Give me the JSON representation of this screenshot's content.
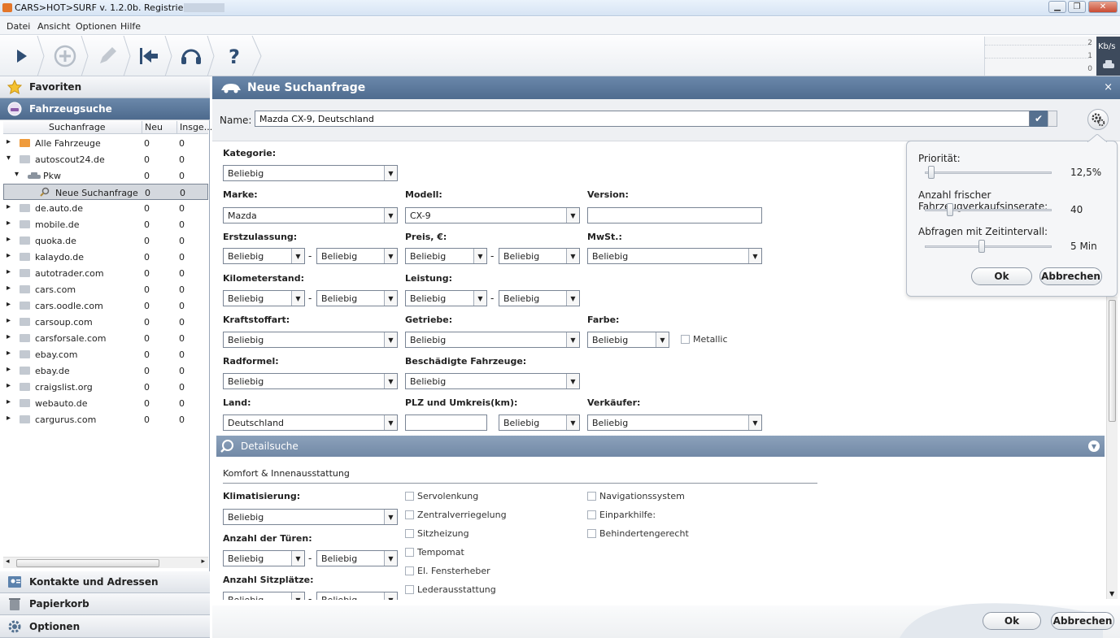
{
  "window": {
    "title": "CARS>HOT>SURF v. 1.2.0b. Registriert für"
  },
  "menu": {
    "items": [
      "Datei",
      "Ansicht",
      "Optionen",
      "Hilfe"
    ]
  },
  "speed": {
    "labels": [
      "2",
      "1",
      "0"
    ],
    "unit": "Kb/s"
  },
  "left": {
    "favorites": "Favoriten",
    "vehicle_search": "Fahrzeugsuche",
    "contacts": "Kontakte und Adressen",
    "trash": "Papierkorb",
    "options": "Optionen",
    "tree_headers": {
      "query": "Suchanfrage",
      "new": "Neu",
      "total": "Insge..."
    },
    "tree": [
      {
        "label": "Alle Fahrzeuge",
        "neu": "0",
        "insg": "0"
      },
      {
        "label": "autoscout24.de",
        "neu": "0",
        "insg": "0"
      },
      {
        "label": "Pkw",
        "neu": "0",
        "insg": "0"
      },
      {
        "label": "Neue Suchanfrage",
        "neu": "0",
        "insg": "0"
      },
      {
        "label": "de.auto.de",
        "neu": "0",
        "insg": "0"
      },
      {
        "label": "mobile.de",
        "neu": "0",
        "insg": "0"
      },
      {
        "label": "quoka.de",
        "neu": "0",
        "insg": "0"
      },
      {
        "label": "kalaydo.de",
        "neu": "0",
        "insg": "0"
      },
      {
        "label": "autotrader.com",
        "neu": "0",
        "insg": "0"
      },
      {
        "label": "cars.com",
        "neu": "0",
        "insg": "0"
      },
      {
        "label": "cars.oodle.com",
        "neu": "0",
        "insg": "0"
      },
      {
        "label": "carsoup.com",
        "neu": "0",
        "insg": "0"
      },
      {
        "label": "carsforsale.com",
        "neu": "0",
        "insg": "0"
      },
      {
        "label": "ebay.com",
        "neu": "0",
        "insg": "0"
      },
      {
        "label": "ebay.de",
        "neu": "0",
        "insg": "0"
      },
      {
        "label": "craigslist.org",
        "neu": "0",
        "insg": "0"
      },
      {
        "label": "webauto.de",
        "neu": "0",
        "insg": "0"
      },
      {
        "label": "cargurus.com",
        "neu": "0",
        "insg": "0"
      }
    ]
  },
  "main": {
    "title": "Neue Suchanfrage",
    "name_label": "Name:",
    "name_value": "Mazda CX-9, Deutschland",
    "labels": {
      "kategorie": "Kategorie:",
      "marke": "Marke:",
      "modell": "Modell:",
      "version": "Version:",
      "erstzulassung": "Erstzulassung:",
      "preis": "Preis, €:",
      "mwst": "MwSt.:",
      "km": "Kilometerstand:",
      "leistung": "Leistung:",
      "kraftstoff": "Kraftstoffart:",
      "getriebe": "Getriebe:",
      "farbe": "Farbe:",
      "radformel": "Radformel:",
      "beschaedigt": "Beschädigte Fahrzeuge:",
      "land": "Land:",
      "plz": "PLZ und Umkreis(km):",
      "verkaeufer": "Verkäufer:"
    },
    "values": {
      "beliebig": "Beliebig",
      "marke": "Mazda",
      "modell": "CX-9",
      "land": "Deutschland"
    },
    "dash": "-",
    "metallic": "Metallic",
    "detail_title": "Detailsuche",
    "komfort_title": "Komfort &  Innenausstattung",
    "klima": "Klimatisierung:",
    "tueren": "Anzahl der Türen:",
    "sitz": "Anzahl Sitzplätze:",
    "checks_col1": [
      "Servolenkung",
      "Zentralverriegelung",
      "Sitzheizung",
      "Tempomat",
      "El. Fensterheber",
      "Lederausstattung"
    ],
    "checks_col2": [
      "Navigationssystem",
      "Einparkhilfe:",
      "Behindertengerecht"
    ],
    "ok": "Ok",
    "cancel": "Abbrechen"
  },
  "popup": {
    "prio_label": "Priorität:",
    "prio_value": "12,5%",
    "prio_level": 0.05,
    "fresh_label": "Anzahl frischer Fahrzeugverkaufsinserate:",
    "fresh_value": "40",
    "fresh_level": 0.2,
    "interval_label": "Abfragen mit Zeitintervall:",
    "interval_value": "5 Min",
    "interval_level": 0.45,
    "ok": "Ok",
    "cancel": "Abbrechen"
  }
}
